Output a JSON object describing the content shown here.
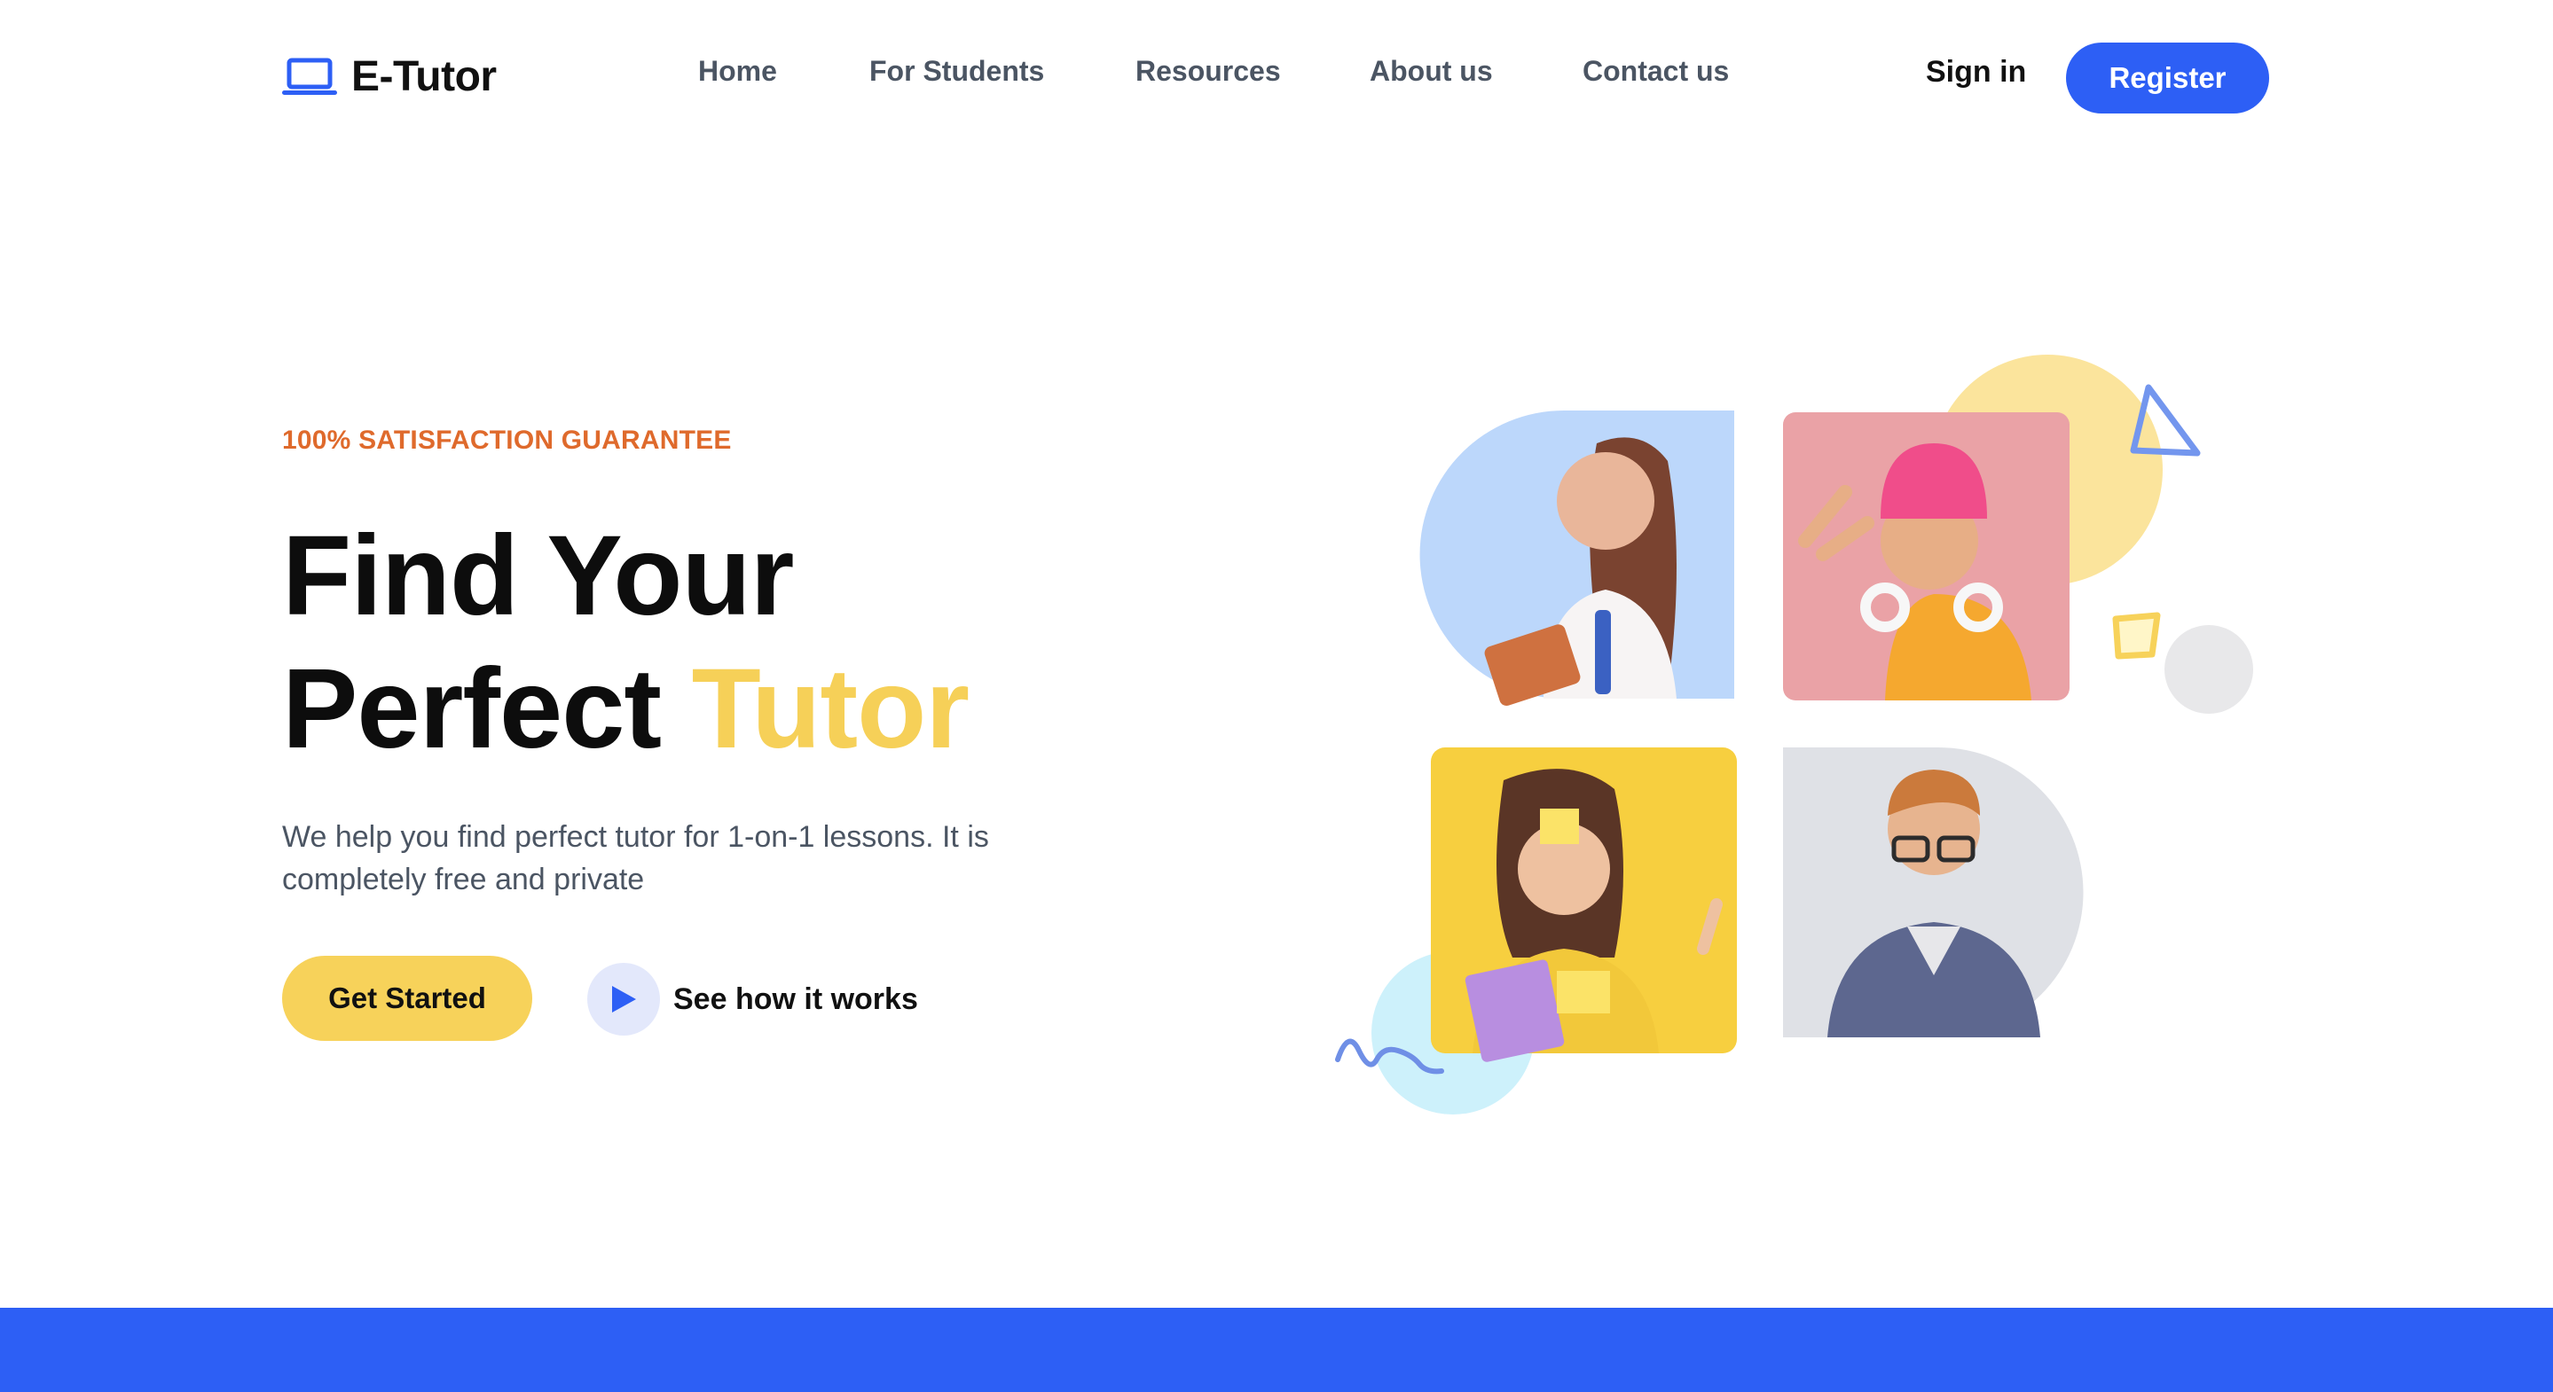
{
  "brand": {
    "name": "E-Tutor",
    "accent_color": "#2d5ff5",
    "secondary_color": "#f7d25a",
    "icon": "laptop-icon"
  },
  "nav": {
    "links": [
      "Home",
      "For Students",
      "Resources",
      "About us",
      "Contact us"
    ],
    "signin_label": "Sign in",
    "register_label": "Register"
  },
  "hero": {
    "eyebrow": "100% SATISFACTION GUARANTEE",
    "headline_line1": "Find Your",
    "headline_line2_start": "Perfect",
    "headline_line2_highlight": "Tutor",
    "subtext": "We help you find perfect tutor for 1-on-1 lessons. It is completely free and private",
    "cta_primary": "Get Started",
    "cta_secondary": "See how it works",
    "play_icon": "play-icon"
  },
  "illustration": {
    "photos": [
      "student-with-notebooks",
      "girl-in-pink-beanie",
      "girl-with-sticky-note",
      "young-man-with-glasses"
    ]
  }
}
